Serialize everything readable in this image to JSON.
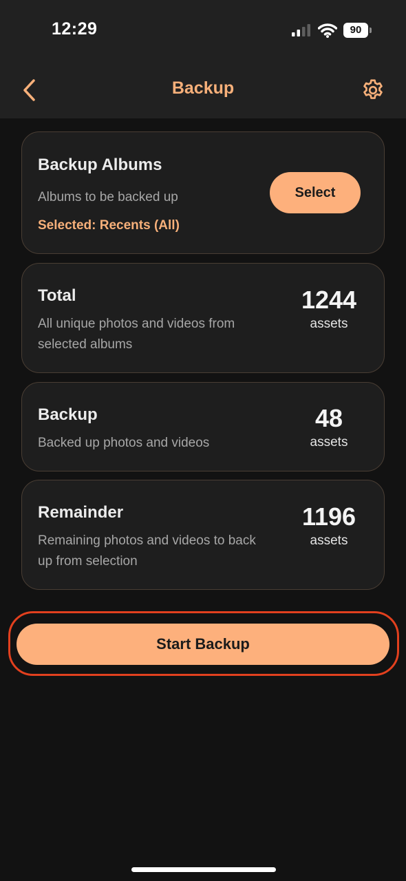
{
  "status_bar": {
    "time": "12:29",
    "battery_level": "90",
    "icons": [
      "signal-icon",
      "wifi-icon",
      "battery-icon"
    ]
  },
  "app_bar": {
    "title": "Backup",
    "back_icon": "chevron-left-icon",
    "settings_icon": "gear-icon"
  },
  "albums_card": {
    "title": "Backup Albums",
    "description": "Albums to be backed up",
    "selected": "Selected: Recents (All)",
    "select_label": "Select"
  },
  "stats": [
    {
      "title": "Total",
      "description": "All unique photos and videos from selected albums",
      "count": "1244",
      "unit": "assets"
    },
    {
      "title": "Backup",
      "description": "Backed up photos and videos",
      "count": "48",
      "unit": "assets"
    },
    {
      "title": "Remainder",
      "description": "Remaining photos and videos to back up from selection",
      "count": "1196",
      "unit": "assets"
    }
  ],
  "start_backup_label": "Start Backup",
  "colors": {
    "accent": "#fdb07c",
    "title_accent": "#f7b07a",
    "background": "#121212",
    "app_bar": "#212121",
    "card": "#1e1e1e",
    "card_border": "#4a3e34",
    "highlight_outline": "#e2401e"
  }
}
